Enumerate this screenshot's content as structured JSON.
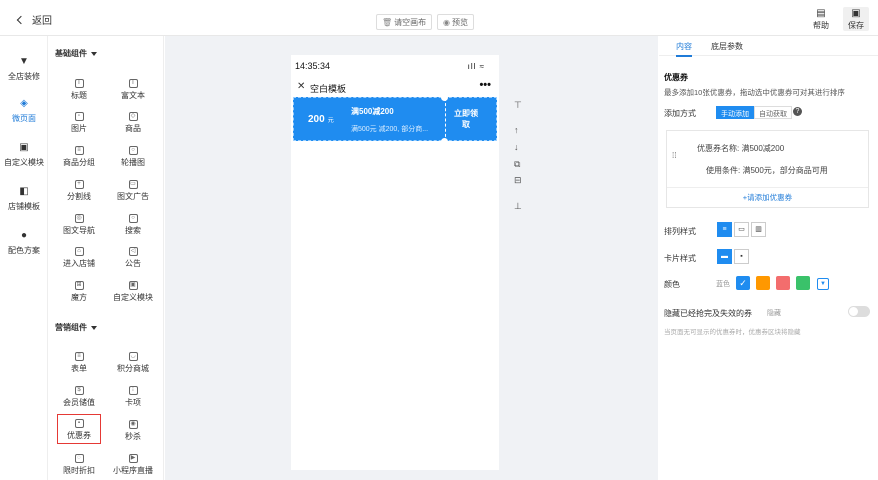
{
  "topbar": {
    "back_label": "返回",
    "clear_label": "请空画布",
    "preview_label": "预览",
    "help_label": "帮助",
    "save_label": "保存"
  },
  "leftnav": [
    {
      "label": "全店装修",
      "icon": "brush-icon"
    },
    {
      "label": "微页面",
      "icon": "cube-icon",
      "active": true
    },
    {
      "label": "自定义模块",
      "icon": "module-icon"
    },
    {
      "label": "店铺模板",
      "icon": "template-icon"
    },
    {
      "label": "配色方案",
      "icon": "palette-icon"
    }
  ],
  "palette": {
    "basic_title": "基础组件",
    "basic": [
      "标题",
      "富文本",
      "图片",
      "商品",
      "商品分组",
      "轮播图",
      "分割线",
      "图文广告",
      "图文导航",
      "搜索",
      "进入店铺",
      "公告",
      "魔方",
      "自定义模块"
    ],
    "marketing_title": "营销组件",
    "marketing": [
      "表单",
      "积分商城",
      "会员储值",
      "卡项",
      "优惠券",
      "秒杀",
      "限时折扣",
      "小程序直播"
    ]
  },
  "phone": {
    "time": "14:35:34",
    "signal": "ıll ≈",
    "title": "空白模板",
    "more": "•••",
    "coupon": {
      "amount": "200",
      "unit": "元",
      "name": "满500减200",
      "desc": "满500元 减200, 部分商...",
      "action": "立即领取"
    }
  },
  "tools": [
    "⊤",
    "↑",
    "↓",
    "⧉",
    "⊟",
    "⊥"
  ],
  "right": {
    "tab_content": "内容",
    "tab_base": "底层参数",
    "section": "优惠券",
    "hint": "最多添加10张优惠券，拖动选中优惠券可对其进行排序",
    "add_mode_label": "添加方式",
    "mode_manual": "手动添加",
    "mode_auto": "自动获取",
    "qmark": "?",
    "coupon_name": "优惠券名称: 满500减200",
    "coupon_cond": "使用条件: 满500元，部分商品可用",
    "add_coupon": "+请添加优惠券",
    "layout_label": "排列样式",
    "card_label": "卡片样式",
    "color_label": "颜色",
    "color_value": "蓝色",
    "colors": [
      "#1f8cf0",
      "#ff9800",
      "#f36d6d",
      "#3ac26a",
      "#1f8cf0"
    ],
    "hide_label": "隐藏已经抢完及失效的券",
    "hide_value": "隐藏",
    "hide_note": "当页面无可显示的优惠券时，优惠券区块将隐藏"
  }
}
